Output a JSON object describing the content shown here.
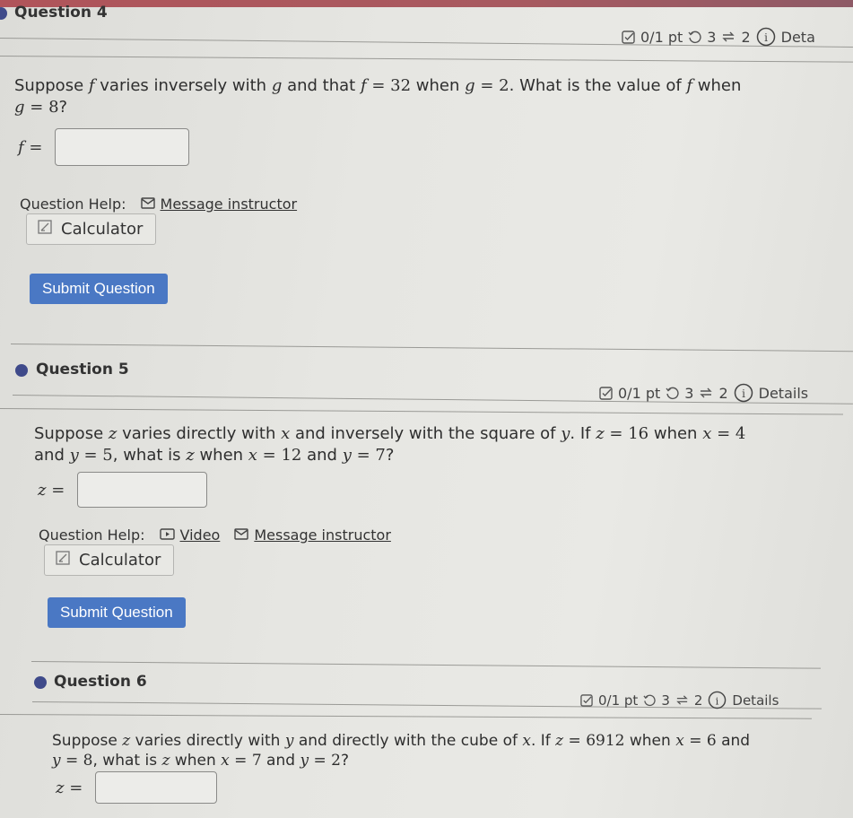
{
  "questions": [
    {
      "title": "Question 4",
      "score": "0/1 pt",
      "retries": "3",
      "attempts": "2",
      "details_label": "Deta",
      "text_line1_parts": [
        "Suppose ",
        "f",
        " varies inversely with ",
        "g",
        " and that ",
        "f",
        " = ",
        "32",
        " when ",
        "g",
        " = ",
        "2",
        ". What is the value of ",
        "f",
        " when"
      ],
      "text_line2_parts": [
        "g",
        " = ",
        "8",
        "?"
      ],
      "answer_label": "f =",
      "answer_value": "",
      "help_label": "Question Help:",
      "message_label": "Message instructor",
      "calculator_label": "Calculator",
      "submit_label": "Submit Question"
    },
    {
      "title": "Question 5",
      "score": "0/1 pt",
      "retries": "3",
      "attempts": "2",
      "details_label": "Details",
      "text_line1_parts": [
        "Suppose ",
        "z",
        " varies directly with ",
        "x",
        " and inversely with the square of ",
        "y",
        ". If ",
        "z",
        " = ",
        "16",
        " when ",
        "x",
        " = ",
        "4"
      ],
      "text_line2_parts": [
        "and ",
        "y",
        " = ",
        "5",
        ", what is ",
        "z",
        " when ",
        "x",
        " = ",
        "12",
        " and ",
        "y",
        " = ",
        "7",
        "?"
      ],
      "answer_label": "z =",
      "answer_value": "",
      "help_label": "Question Help:",
      "video_label": "Video",
      "message_label": "Message instructor",
      "calculator_label": "Calculator",
      "submit_label": "Submit Question"
    },
    {
      "title": "Question 6",
      "score": "0/1 pt",
      "retries": "3",
      "attempts": "2",
      "details_label": "Details",
      "text_line1_parts": [
        "Suppose ",
        "z",
        " varies directly with ",
        "y",
        " and directly with the cube of ",
        "x",
        ". If ",
        "z",
        " = ",
        "6912",
        " when ",
        "x",
        " = ",
        "6",
        " and"
      ],
      "text_line2_parts": [
        "y",
        " = ",
        "8",
        ", what is ",
        "z",
        " when ",
        "x",
        " = ",
        "7",
        " and ",
        "y",
        " = ",
        "2",
        "?"
      ],
      "answer_label": "z =",
      "answer_value": ""
    }
  ],
  "colors": {
    "submit": "#4a78c4",
    "bullet": "#3f4a8a"
  }
}
